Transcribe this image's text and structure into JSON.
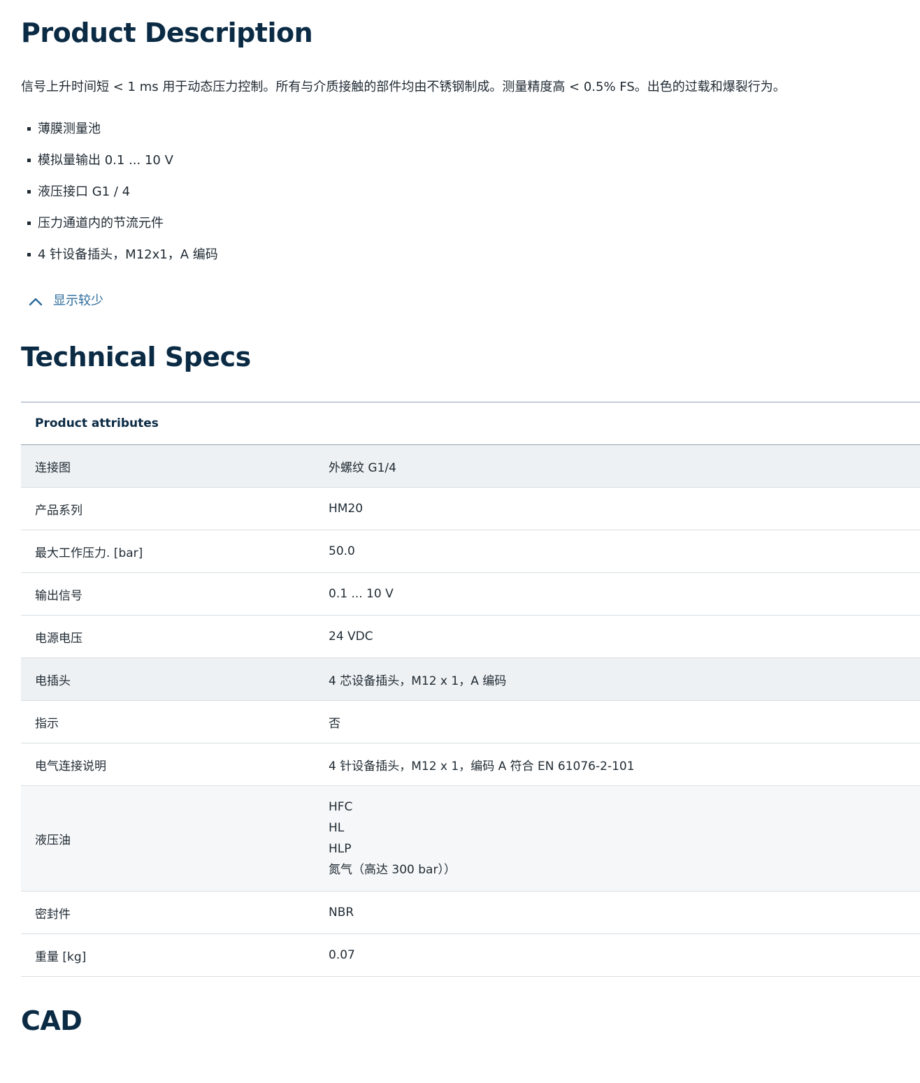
{
  "product_description": {
    "title": "Product Description",
    "text": "信号上升时间短 < 1 ms 用于动态压力控制。所有与介质接触的部件均由不锈钢制成。测量精度高 < 0.5% FS。出色的过载和爆裂行为。",
    "features": [
      "薄膜测量池",
      "模拟量输出 0.1 ... 10 V",
      "液压接口 G1 / 4",
      "压力通道内的节流元件",
      "4 针设备插头，M12x1，A 编码"
    ],
    "show_less_label": "显示较少"
  },
  "technical_specs": {
    "title": "Technical Specs",
    "table_header": "Product attributes",
    "rows": [
      {
        "label": "连接图",
        "value": "外螺纹 G1/4"
      },
      {
        "label": "产品系列",
        "value": "HM20"
      },
      {
        "label": "最大工作压力. [bar]",
        "value": "50.0"
      },
      {
        "label": "输出信号",
        "value": "0.1 ... 10 V"
      },
      {
        "label": "电源电压",
        "value": "24 VDC"
      },
      {
        "label": "电插头",
        "value": "4 芯设备插头，M12 x 1，A 编码"
      },
      {
        "label": "指示",
        "value": "否"
      },
      {
        "label": "电气连接说明",
        "value": "4 针设备插头，M12 x 1，编码 A 符合 EN 61076-2-101"
      },
      {
        "label": "液压油",
        "values": [
          "HFC",
          "HL",
          "HLP",
          "氮气（高达 300 bar））"
        ]
      },
      {
        "label": "密封件",
        "value": "NBR"
      },
      {
        "label": "重量 [kg]",
        "value": "0.07"
      }
    ]
  },
  "cad": {
    "title": "CAD"
  },
  "icons": {
    "show_less": "chevron-up-icon"
  },
  "colors": {
    "heading": "#0b2b45",
    "link": "#2a6a9a",
    "row_shade": "#eef1f3"
  }
}
